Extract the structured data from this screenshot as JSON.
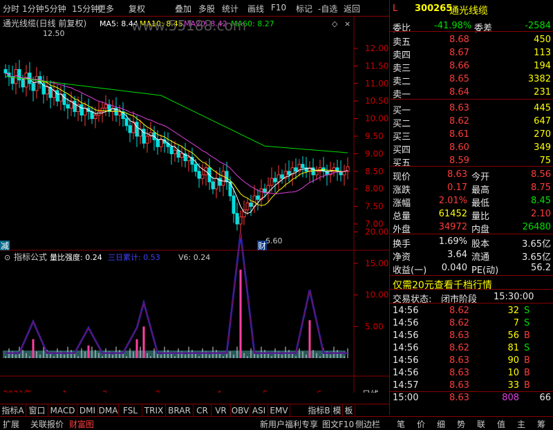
{
  "toolbar": {
    "items": [
      "分时",
      "1分钟",
      "5分钟",
      "15分钟",
      "更多",
      "复权",
      "叠加",
      "多股",
      "统计",
      "画线",
      "F10",
      "标记",
      "-自选",
      "返回"
    ]
  },
  "main_chart": {
    "title": "通光线缆(日线 前复权)",
    "ma": [
      {
        "label": "MA5: 8.44",
        "color": "#ffffff"
      },
      {
        "label": "MA10: 8.45",
        "color": "#ffff00"
      },
      {
        "label": "MA20: 8.42",
        "color": "#e040e0"
      },
      {
        "label": "MA60: 8.27",
        "color": "#00e000"
      }
    ],
    "watermark": "www.55188.com",
    "high_note": "12.50",
    "low_note": "6.60",
    "badge_jian": "减",
    "badge_cai": "财",
    "y_ticks": [
      "12.00",
      "11.50",
      "11.00",
      "10.50",
      "10.00",
      "9.50",
      "9.00",
      "8.50",
      "8.00",
      "7.50",
      "7.00"
    ]
  },
  "sub_chart": {
    "title": "指标公式",
    "labels": [
      {
        "label": "量比强度: 0.24",
        "color": "#ffffff"
      },
      {
        "label": "三日累计: 0.53",
        "color": "#4040ff"
      },
      {
        "label": "V6: 0.24",
        "color": "#cccccc"
      }
    ],
    "y_ticks": [
      "20.00",
      "15.00",
      "10.00",
      "5.00"
    ]
  },
  "x_axis": {
    "labels": [
      "2021年",
      "1",
      "2",
      "3",
      "4",
      "5",
      "6"
    ],
    "period": "日线"
  },
  "tabs": [
    "指标A",
    "窗口",
    "MACD",
    "DMI",
    "DMA",
    "FSL",
    "TRIX",
    "BRAR",
    "CR",
    "VR",
    "OBV",
    "ASI",
    "EMV",
    "指标B",
    "模",
    "板"
  ],
  "status": {
    "left": [
      "扩展",
      "关联报价",
      "财富图"
    ],
    "middle": [
      "新用户福利专享",
      "图文F10",
      "侧边栏"
    ],
    "right_tabs": [
      "笔",
      "价",
      "细",
      "势",
      "联",
      "值",
      "主",
      "筹"
    ]
  },
  "quote": {
    "flag": "L",
    "code": "300265",
    "name": "通光线缆",
    "weibi_label": "委比",
    "weibi": "-41.98%",
    "weicha_label": "委差",
    "weicha": "-2584",
    "asks": [
      {
        "label": "卖五",
        "price": "8.68",
        "vol": "450"
      },
      {
        "label": "卖四",
        "price": "8.67",
        "vol": "113"
      },
      {
        "label": "卖三",
        "price": "8.66",
        "vol": "194"
      },
      {
        "label": "卖二",
        "price": "8.65",
        "vol": "3382"
      },
      {
        "label": "卖一",
        "price": "8.64",
        "vol": "231"
      }
    ],
    "bids": [
      {
        "label": "买一",
        "price": "8.63",
        "vol": "445"
      },
      {
        "label": "买二",
        "price": "8.62",
        "vol": "647"
      },
      {
        "label": "买三",
        "price": "8.61",
        "vol": "270"
      },
      {
        "label": "买四",
        "price": "8.60",
        "vol": "349"
      },
      {
        "label": "买五",
        "price": "8.59",
        "vol": "75"
      }
    ],
    "stats": [
      {
        "l1": "现价",
        "v1": "8.63",
        "c1": "red",
        "l2": "今开",
        "v2": "8.56",
        "c2": "red"
      },
      {
        "l1": "涨跌",
        "v1": "0.17",
        "c1": "red",
        "l2": "最高",
        "v2": "8.75",
        "c2": "red"
      },
      {
        "l1": "涨幅",
        "v1": "2.01%",
        "c1": "red",
        "l2": "最低",
        "v2": "8.45",
        "c2": "green"
      },
      {
        "l1": "总量",
        "v1": "61452",
        "c1": "yellow",
        "l2": "量比",
        "v2": "2.10",
        "c2": "red"
      },
      {
        "l1": "外盘",
        "v1": "34972",
        "c1": "red",
        "l2": "内盘",
        "v2": "26480",
        "c2": "green"
      }
    ],
    "stats2": [
      {
        "l1": "换手",
        "v1": "1.69%",
        "l2": "股本",
        "v2": "3.65亿"
      },
      {
        "l1": "净资",
        "v1": "3.64",
        "l2": "流通",
        "v2": "3.65亿"
      },
      {
        "l1": "收益(一)",
        "v1": "0.040",
        "l2": "PE(动)",
        "v2": "56.2"
      }
    ],
    "promo": "仅需20元查看千档行情",
    "trade_status_label": "交易状态:",
    "trade_status": "闭市阶段",
    "trade_time": "15:30:00",
    "ticks": [
      {
        "time": "14:56",
        "price": "8.62",
        "vol": "32",
        "bs": "S"
      },
      {
        "time": "14:56",
        "price": "8.62",
        "vol": "7",
        "bs": "S"
      },
      {
        "time": "14:56",
        "price": "8.63",
        "vol": "56",
        "bs": "B"
      },
      {
        "time": "14:56",
        "price": "8.62",
        "vol": "81",
        "bs": "S"
      },
      {
        "time": "14:56",
        "price": "8.63",
        "vol": "90",
        "bs": "B"
      },
      {
        "time": "14:56",
        "price": "8.63",
        "vol": "10",
        "bs": "B"
      },
      {
        "time": "14:57",
        "price": "8.63",
        "vol": "33",
        "bs": "B"
      },
      {
        "time": "15:00",
        "price": "8.63",
        "vol": "808",
        "bs": "",
        "extra": "66"
      }
    ]
  }
}
